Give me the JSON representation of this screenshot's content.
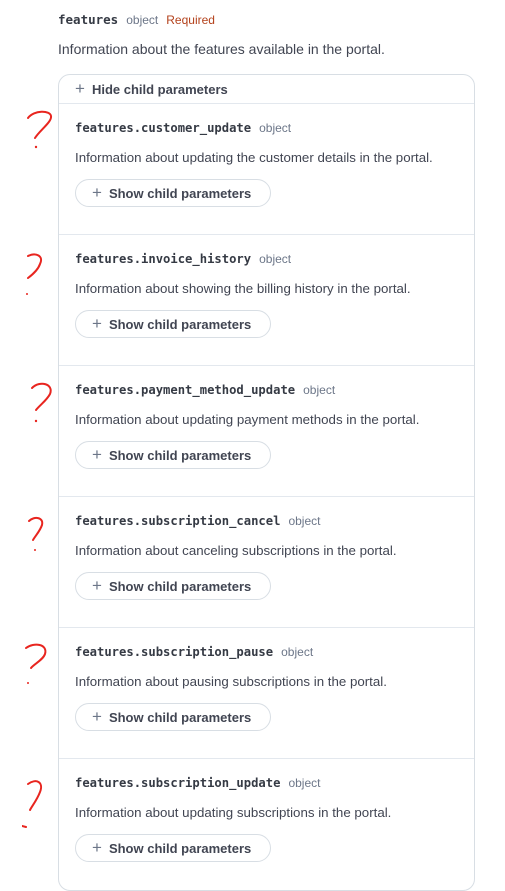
{
  "param": {
    "name": "features",
    "type": "object",
    "required": "Required",
    "description": "Information about the features available in the portal.",
    "hide_label": "Hide child parameters"
  },
  "children": [
    {
      "name": "features.customer_update",
      "type": "object",
      "description": "Information about updating the customer details in the portal.",
      "button": "Show child parameters"
    },
    {
      "name": "features.invoice_history",
      "type": "object",
      "description": "Information about showing the billing history in the portal.",
      "button": "Show child parameters"
    },
    {
      "name": "features.payment_method_update",
      "type": "object",
      "description": "Information about updating payment methods in the portal.",
      "button": "Show child parameters"
    },
    {
      "name": "features.subscription_cancel",
      "type": "object",
      "description": "Information about canceling subscriptions in the portal.",
      "button": "Show child parameters"
    },
    {
      "name": "features.subscription_pause",
      "type": "object",
      "description": "Information about pausing subscriptions in the portal.",
      "button": "Show child parameters"
    },
    {
      "name": "features.subscription_update",
      "type": "object",
      "description": "Information about updating subscriptions in the portal.",
      "button": "Show child parameters"
    }
  ],
  "annotations": {
    "symbol": "?",
    "color": "#e8251f"
  },
  "colors": {
    "required": "#b3411b",
    "border": "#d8dee4",
    "text": "#414552"
  }
}
